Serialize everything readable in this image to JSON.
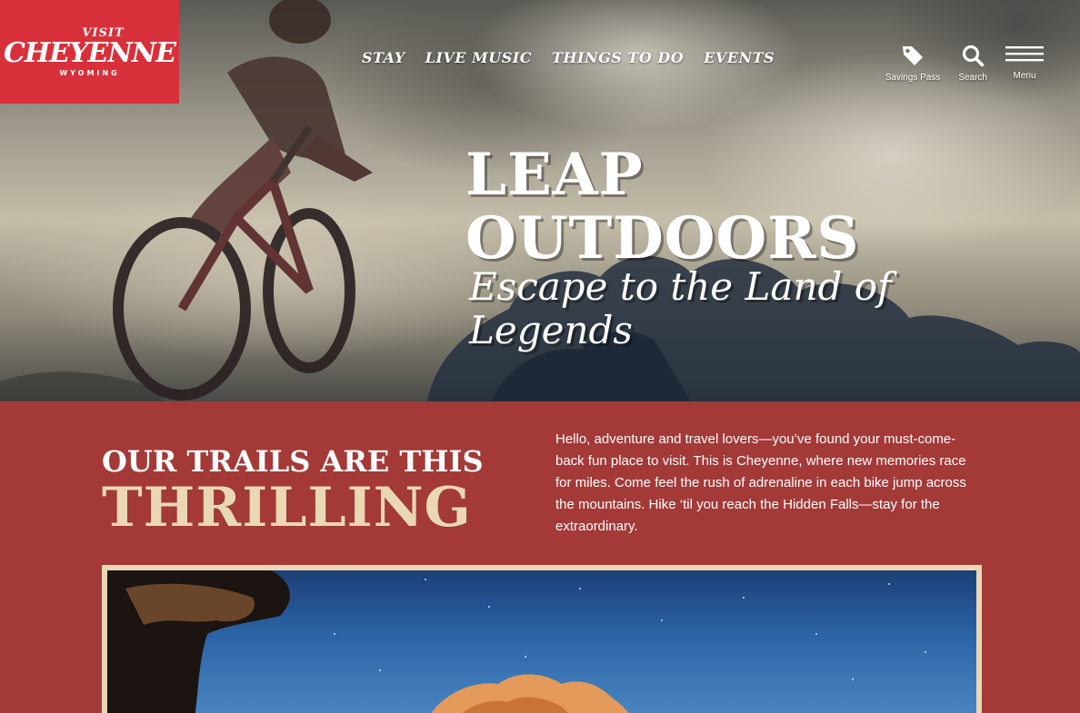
{
  "logo": {
    "visit": "VISIT",
    "name": "CHEYENNE",
    "sub": "WYOMING"
  },
  "nav": {
    "items": [
      {
        "label": "STAY"
      },
      {
        "label": "LIVE MUSIC"
      },
      {
        "label": "THINGS TO DO"
      },
      {
        "label": "EVENTS"
      }
    ]
  },
  "tools": {
    "savings": {
      "label": "Savings Pass",
      "icon": "tag-icon"
    },
    "search": {
      "label": "Search",
      "icon": "search-icon"
    },
    "menu": {
      "label": "Menu",
      "icon": "hamburger-icon"
    }
  },
  "hero": {
    "headline": "LEAP OUTDOORS",
    "subheadline": "Escape to the Land of Legends"
  },
  "intro": {
    "line1": "OUR TRAILS ARE THIS",
    "line2": "THRILLING",
    "body": "Hello, adventure and travel lovers—you’ve found your must-come-back fun place to visit. This is Cheyenne, where new memories race for miles. Come feel the rush of adrenaline in each bike jump across the mountains. Hike ‘til you reach the Hidden Falls—stay for the extraordinary."
  },
  "colors": {
    "logo_red": "#d8303a",
    "section_red": "#a33a38",
    "accent_cream": "#ead8b4"
  }
}
